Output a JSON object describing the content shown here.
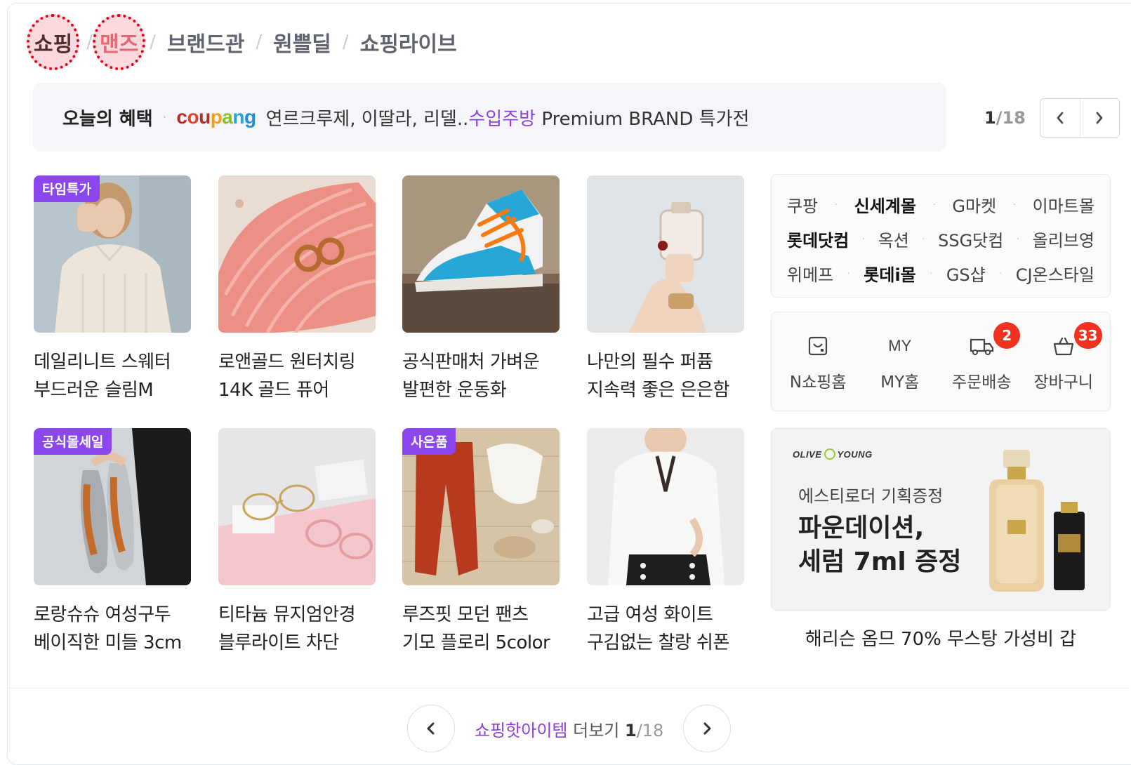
{
  "tabs": [
    {
      "label": "쇼핑",
      "active": true
    },
    {
      "label": "맨즈",
      "active": false
    },
    {
      "label": "브랜드관",
      "active": false
    },
    {
      "label": "원쁠딜",
      "active": false
    },
    {
      "label": "쇼핑라이브",
      "active": false
    }
  ],
  "tab_separator": "/",
  "benefit": {
    "label": "오늘의 혜택",
    "logo_parts": [
      "c",
      "o",
      "u",
      "p",
      "a",
      "n",
      "g"
    ],
    "text_before": "연르크루제, 이딸라, 리델..",
    "text_highlight": "수입주방",
    "text_after": " Premium BRAND 특가전",
    "page_current": "1",
    "page_total": "/18"
  },
  "products": [
    {
      "tag": "타임특가",
      "line1": "데일리니트 스웨터",
      "line2": "부드러운 슬림M",
      "image": "sweater"
    },
    {
      "tag": "",
      "line1": "로앤골드 원터치링",
      "line2": "14K 골드 퓨어",
      "image": "earrings"
    },
    {
      "tag": "",
      "line1": "공식판매처 가벼운",
      "line2": "발편한 운동화",
      "image": "sneaker"
    },
    {
      "tag": "",
      "line1": "나만의 필수 퍼퓸",
      "line2": "지속력 좋은 은은함",
      "image": "perfume"
    },
    {
      "tag": "공식몰세일",
      "line1": "로랑슈슈 여성구두",
      "line2": "베이직한 미들 3cm",
      "image": "shoes"
    },
    {
      "tag": "",
      "line1": "티타늄 뮤지엄안경",
      "line2": "블루라이트 차단",
      "image": "glasses"
    },
    {
      "tag": "사은품",
      "line1": "루즈핏 모던 팬츠",
      "line2": "기모 플로리 5color",
      "image": "pants"
    },
    {
      "tag": "",
      "line1": "고급 여성 화이트",
      "line2": "구김없는 찰랑 쉬폰",
      "image": "blouse"
    }
  ],
  "shops": {
    "rows": [
      [
        {
          "label": "쿠팡",
          "bold": false
        },
        {
          "label": "신세계몰",
          "bold": true
        },
        {
          "label": "G마켓",
          "bold": false
        },
        {
          "label": "이마트몰",
          "bold": false
        }
      ],
      [
        {
          "label": "롯데닷컴",
          "bold": true
        },
        {
          "label": "옥션",
          "bold": false
        },
        {
          "label": "SSG닷컴",
          "bold": false
        },
        {
          "label": "올리브영",
          "bold": false
        }
      ],
      [
        {
          "label": "위메프",
          "bold": false
        },
        {
          "label": "롯데i몰",
          "bold": true
        },
        {
          "label": "GS샵",
          "bold": false
        },
        {
          "label": "CJ온스타일",
          "bold": false
        }
      ]
    ]
  },
  "quick_menu": [
    {
      "label": "N쇼핑홈",
      "icon": "shopping-bag-icon",
      "icon_text": "",
      "badge": ""
    },
    {
      "label": "MY홈",
      "icon": "my-text-icon",
      "icon_text": "MY",
      "badge": ""
    },
    {
      "label": "주문배송",
      "icon": "delivery-truck-icon",
      "icon_text": "",
      "badge": "2"
    },
    {
      "label": "장바구니",
      "icon": "basket-icon",
      "icon_text": "",
      "badge": "33"
    }
  ],
  "ad": {
    "brand_left": "OLIVE",
    "brand_right": "YOUNG",
    "sub": "에스티로더 기획증정",
    "headline1": "파운데이션,",
    "headline2": "세럼 7ml 증정",
    "caption": "해리슨 옴므 70% 무스탕 가성비 갑"
  },
  "more": {
    "highlight": "쇼핑핫아이템",
    "text": " 더보기 ",
    "current": "1",
    "total": "/18"
  },
  "colors": {
    "accent_purple": "#8f3ee0",
    "tag_purple": "#8b46ee",
    "badge_red": "#f0321e",
    "circle_red": "#e5001c"
  }
}
